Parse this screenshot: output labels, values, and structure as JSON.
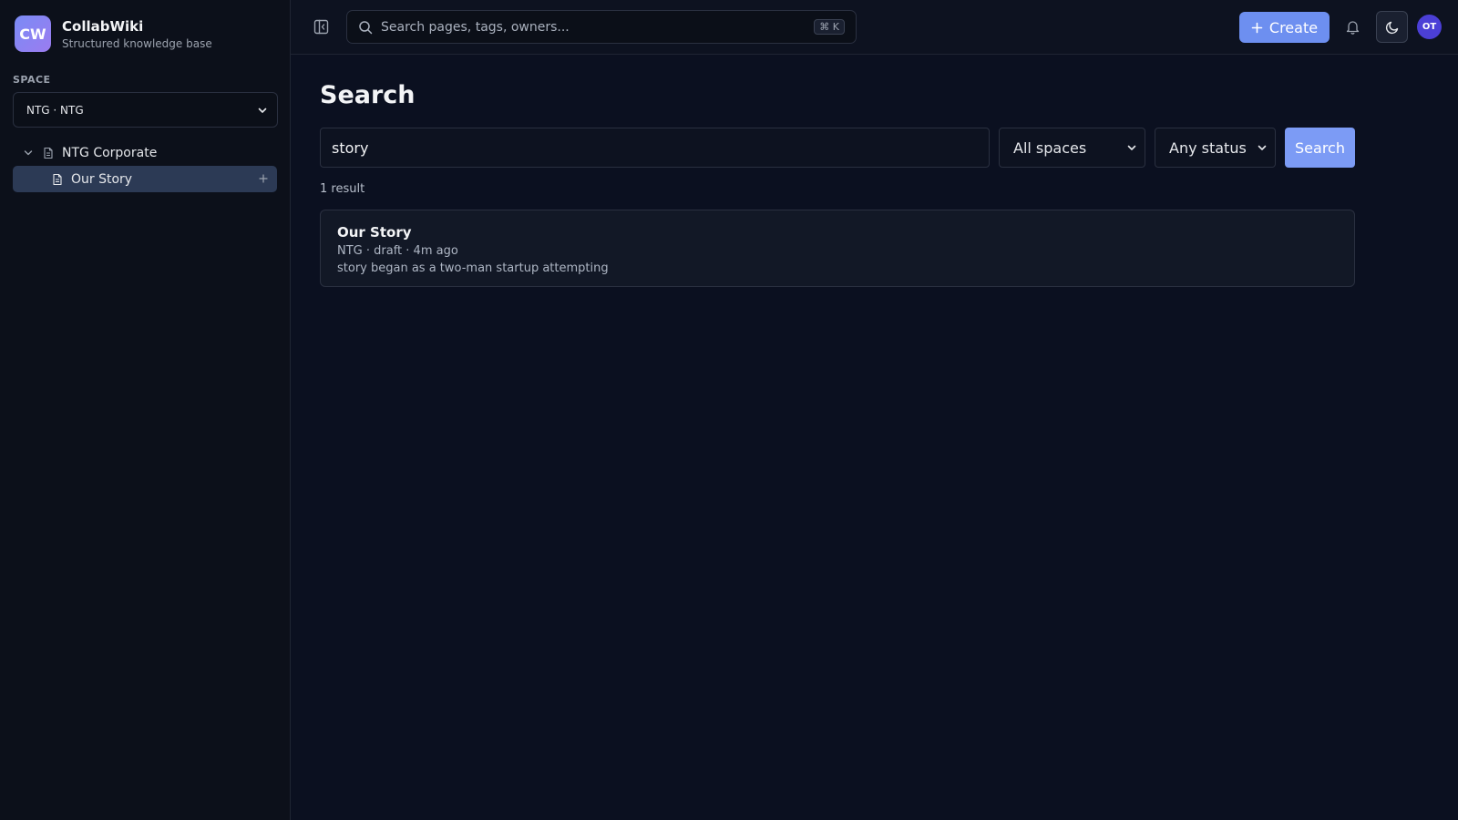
{
  "brand": {
    "logo_text": "CW",
    "name": "CollabWiki",
    "subtitle": "Structured knowledge base"
  },
  "sidebar": {
    "space_label": "SPACE",
    "space_selected": "NTG · NTG",
    "tree": [
      {
        "label": "NTG Corporate",
        "expanded": true
      },
      {
        "label": "Our Story",
        "selected": true
      }
    ]
  },
  "topbar": {
    "search_placeholder": "Search pages, tags, owners...",
    "shortcut": "⌘ K",
    "create_label": "Create",
    "avatar_initials": "OT"
  },
  "main": {
    "title": "Search",
    "query": "story",
    "space_filter": "All spaces",
    "status_filter": "Any status",
    "search_button": "Search",
    "result_count": "1 result",
    "results": [
      {
        "title": "Our Story",
        "meta": "NTG · draft · 4m ago",
        "snippet": "story began as a two-man startup attempting"
      }
    ]
  },
  "colors": {
    "accent": "#6d8ff0",
    "search_button": "#7c9bf5",
    "avatar": "#4b3fd6",
    "selected_tree_item": "#2c3a55"
  }
}
